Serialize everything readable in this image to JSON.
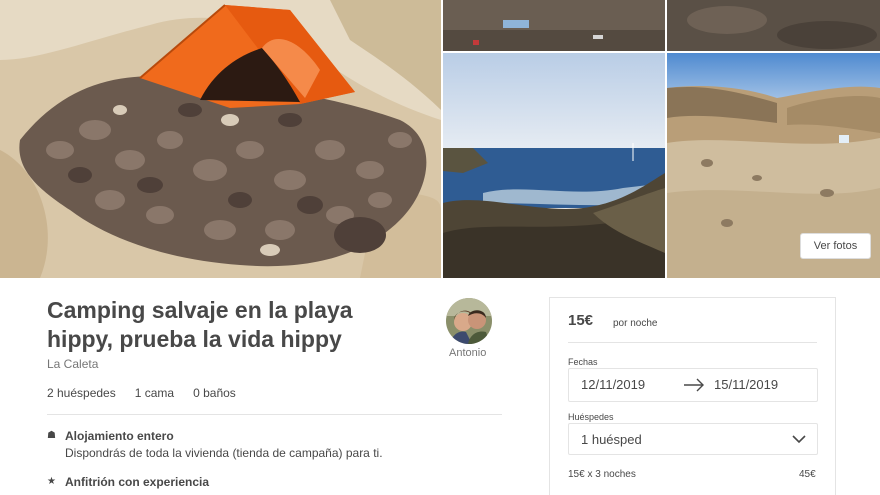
{
  "gallery": {
    "view_photos_label": "Ver fotos",
    "photos": [
      "tent-on-rocks",
      "beach-litter",
      "rocky-ground",
      "sea-cove",
      "rocky-valley"
    ]
  },
  "listing": {
    "title_line1": "Camping salvaje en la playa",
    "title_line2": "hippy, prueba la vida hippy",
    "location": "La Caleta",
    "stats": {
      "guests": "2 huéspedes",
      "beds": "1 cama",
      "baths": "0 baños"
    },
    "features": [
      {
        "icon": "home-icon",
        "title": "Alojamiento entero",
        "description": "Dispondrás de toda la vivienda (tienda de campaña) para ti."
      },
      {
        "icon": "star-icon",
        "title": "Anfitrión con experiencia",
        "description": ""
      }
    ]
  },
  "host": {
    "name": "Antonio"
  },
  "booking": {
    "price": "15€",
    "price_unit": "por noche",
    "dates_label": "Fechas",
    "check_in": "12/11/2019",
    "check_out": "15/11/2019",
    "guests_label": "Huéspedes",
    "guests_value": "1 huésped",
    "calc_label": "15€ x 3 noches",
    "calc_total": "45€"
  },
  "colors": {
    "text": "#484848",
    "muted": "#767676",
    "border": "#e4e4e4",
    "tent_orange": "#f06a1c"
  }
}
